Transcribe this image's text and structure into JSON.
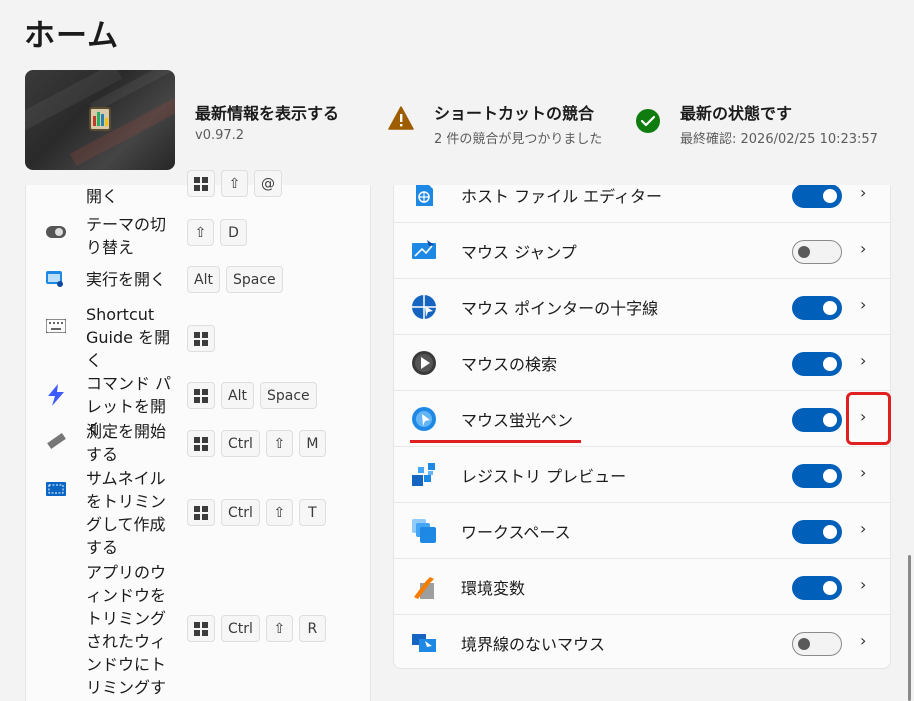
{
  "page": {
    "title": "ホーム"
  },
  "header": {
    "update": {
      "title": "最新情報を表示する",
      "version": "v0.97.2"
    },
    "conflict": {
      "title": "ショートカットの競合",
      "sub": "2 件の競合が見つかりました"
    },
    "status": {
      "title": "最新の状態です",
      "sub": "最終確認:  2026/02/25 10:23:57"
    }
  },
  "shortcuts": [
    {
      "label": "開く",
      "keys": [
        "win",
        "shift",
        "@"
      ]
    },
    {
      "label": "テーマの切り替え",
      "keys": [
        "shift",
        "D"
      ]
    },
    {
      "label": "実行を開く",
      "keys": [
        "Alt",
        "Space"
      ]
    },
    {
      "label": "Shortcut Guide を開く",
      "keys": [
        "win"
      ]
    },
    {
      "label": "コマンド パレットを開く",
      "keys": [
        "win",
        "Alt",
        "Space"
      ]
    },
    {
      "label": "測定を開始する",
      "keys": [
        "win",
        "Ctrl",
        "shift",
        "M"
      ]
    },
    {
      "label": "サムネイルをトリミングして作成する",
      "keys": [
        "win",
        "Ctrl",
        "shift",
        "T"
      ]
    },
    {
      "label": "アプリのウィンドウをトリミングされたウィンドウにトリミングする",
      "keys": [
        "win",
        "Ctrl",
        "shift",
        "R"
      ]
    }
  ],
  "modules": [
    {
      "label": "ホスト ファイル エディター",
      "enabled": true,
      "icon": "hosts-file-icon"
    },
    {
      "label": "マウス ジャンプ",
      "enabled": false,
      "icon": "mouse-jump-icon"
    },
    {
      "label": "マウス ポインターの十字線",
      "enabled": true,
      "icon": "crosshairs-icon"
    },
    {
      "label": "マウスの検索",
      "enabled": true,
      "icon": "find-mouse-icon"
    },
    {
      "label": "マウス蛍光ペン",
      "enabled": true,
      "icon": "mouse-highlighter-icon"
    },
    {
      "label": "レジストリ プレビュー",
      "enabled": true,
      "icon": "registry-preview-icon"
    },
    {
      "label": "ワークスペース",
      "enabled": true,
      "icon": "workspaces-icon"
    },
    {
      "label": "環境変数",
      "enabled": true,
      "icon": "environment-variables-icon"
    },
    {
      "label": "境界線のないマウス",
      "enabled": false,
      "icon": "mouse-without-borders-icon"
    }
  ],
  "colors": {
    "accent": "#005fb8",
    "highlight": "#e02020"
  }
}
